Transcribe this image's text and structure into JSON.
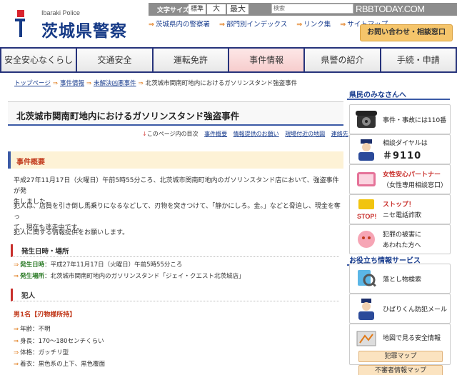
{
  "header": {
    "logo_en": "Ibaraki Police",
    "logo_ja": "茨城県警察",
    "font_size_label": "文字サイズ",
    "font_sizes": [
      "標準",
      "大",
      "最大"
    ],
    "search_placeholder": "検索",
    "watermark": "RBBTODAY.COM",
    "links": [
      "茨城県内の警察署",
      "部門別インデックス",
      "リンク集",
      "サイトマップ"
    ],
    "contact_button": "お問い合わせ・相談窓口"
  },
  "nav": {
    "items": [
      "安全安心なくらし",
      "交通安全",
      "運転免許",
      "事件情報",
      "県警の紹介",
      "手続・申請"
    ],
    "active_index": 3
  },
  "breadcrumb": [
    "トップページ",
    "事件情報",
    "未解決凶悪事件",
    "北茨城市関南町地内におけるガソリンスタンド強盗事件"
  ],
  "main": {
    "title": "北茨城市関南町地内におけるガソリンスタンド強盗事件",
    "toc_label": "このページ内の目次",
    "toc_links": [
      "事件概要",
      "情報提供のお願い",
      "現場付近の地図",
      "連絡先"
    ],
    "section_overview": "事件概要",
    "para1_line1": "平成27年11月17日（火曜日）午前5時55分ころ、北茨城市関南町地内のガソリンスタンド店において、強盗事件が発",
    "para1_line2": "生しました。",
    "para2_line1": "犯人は、店員を引き倒し馬乗りになるなどして、刃物を突きつけて、「静かにしろ。金。」などと脅迫し、現金を奪っ",
    "para2_line2": "て、現在も逃走中です。",
    "para3": "犯人に関する情報提供をお願いします。",
    "sub_datetime": "発生日時・場所",
    "dt_label": "発生日時",
    "dt_value": "：平成27年11月17日（火曜日）午前5時55分ころ",
    "place_label": "発生場所",
    "place_value": "：北茨城市関南町地内のガソリンスタンド「ジェイ・クエスト北茨城店」",
    "sub_suspect": "犯人",
    "man": "男1名【刃物様所持】",
    "traits": [
      "年齢：不明",
      "身長：170～180センチくらい",
      "体格：ガッチリ型",
      "着衣：黒色系の上下、黒色覆面"
    ]
  },
  "sidebar": {
    "heading1": "県民のみなさんへ",
    "card_110": "事件・事故には110番",
    "card_9110_l1": "相談ダイヤルは",
    "card_9110_l2": "＃9110",
    "card_women_l1": "女性安心パートナー",
    "card_women_l2": "（女性専用相談窓口）",
    "card_stop_l1": "ストップ！",
    "card_stop_l2": "ニセ電話詐欺",
    "stop_icon_text": "STOP!",
    "card_victim_l1": "犯罪の被害に",
    "card_victim_l2": "あわれた方へ",
    "heading2": "お役立ち情報サービス",
    "card_lost": "落とし物検索",
    "card_mail": "ひばりくん防犯メール",
    "card_map": "地図で見る安全情報",
    "btn_crime_map": "犯罪マップ",
    "btn_suspicious_map": "不審者情報マップ"
  }
}
